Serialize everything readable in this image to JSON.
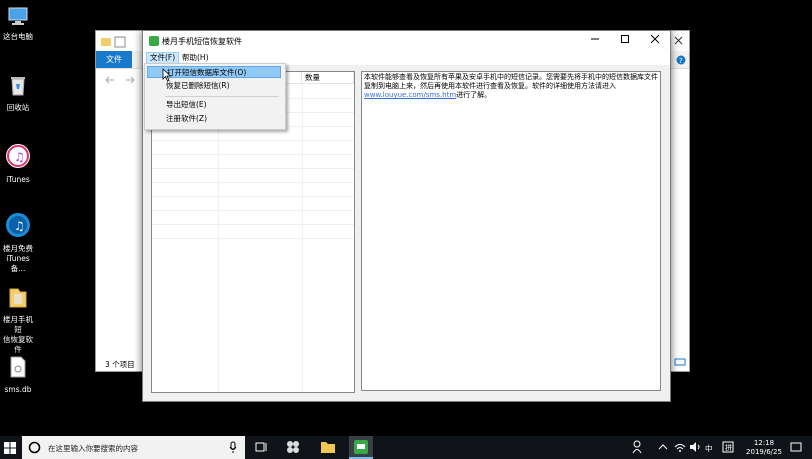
{
  "desktop": {
    "icons": [
      {
        "label": "这台电脑",
        "icon": "computer-icon"
      },
      {
        "label": "回收站",
        "icon": "recycle-bin-icon"
      },
      {
        "label": "iTunes",
        "icon": "itunes-icon"
      },
      {
        "label_line1": "楼月免费",
        "label_line2": "iTunes备...",
        "icon": "itunes-backup-icon"
      },
      {
        "label_line1": "楼月手机短",
        "label_line2": "信恢复软件",
        "icon": "folder-icon"
      },
      {
        "label": "sms.db",
        "icon": "file-icon"
      }
    ]
  },
  "explorer": {
    "file_tab": "文件",
    "item_count": "3 个项目"
  },
  "app": {
    "title": "楼月手机短信恢复软件",
    "menu": {
      "file": "文件(F)",
      "help": "帮助(H)"
    },
    "list": {
      "col_count": "数量"
    },
    "info_text_1": "本软件能够查看及恢复所有苹果及安卓手机中的短信记录。您需要先将手机中的短信数据库文件复制到电脑上来，然后再使用本软件进行查看及恢复。软件的详细使用方法请进入",
    "info_link": "www.louyue.com/sms.htm",
    "info_text_2": "进行了解。",
    "dropdown": {
      "open": "打开短信数据库文件(O)",
      "recover": "恢复已删除短信(R)",
      "export": "导出短信(E)",
      "register": "注册软件(Z)"
    }
  },
  "taskbar": {
    "search_placeholder": "在这里输入你要搜索的内容",
    "ime": "中",
    "clock_time": "12:18",
    "clock_date": "2019/6/25"
  },
  "colors": {
    "accent": "#1979ca",
    "highlight": "#91c9f7",
    "app_icon": "#39a847"
  }
}
